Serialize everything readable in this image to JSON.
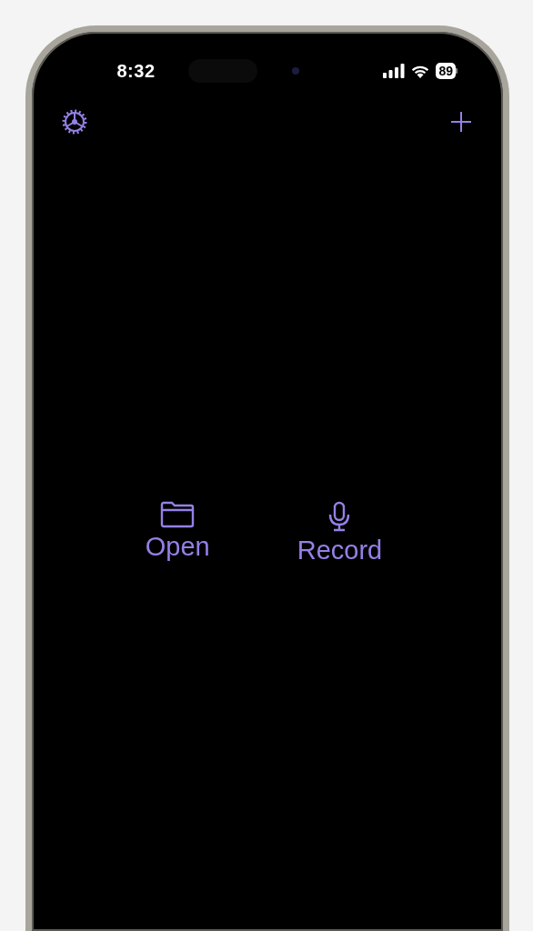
{
  "status_bar": {
    "time": "8:32",
    "battery": "89"
  },
  "toolbar": [
    {
      "kind": "settings"
    },
    {
      "kind": "add"
    }
  ],
  "actions": [
    {
      "kind": "folder",
      "label": "Open"
    },
    {
      "kind": "mic",
      "label": "Record"
    }
  ]
}
